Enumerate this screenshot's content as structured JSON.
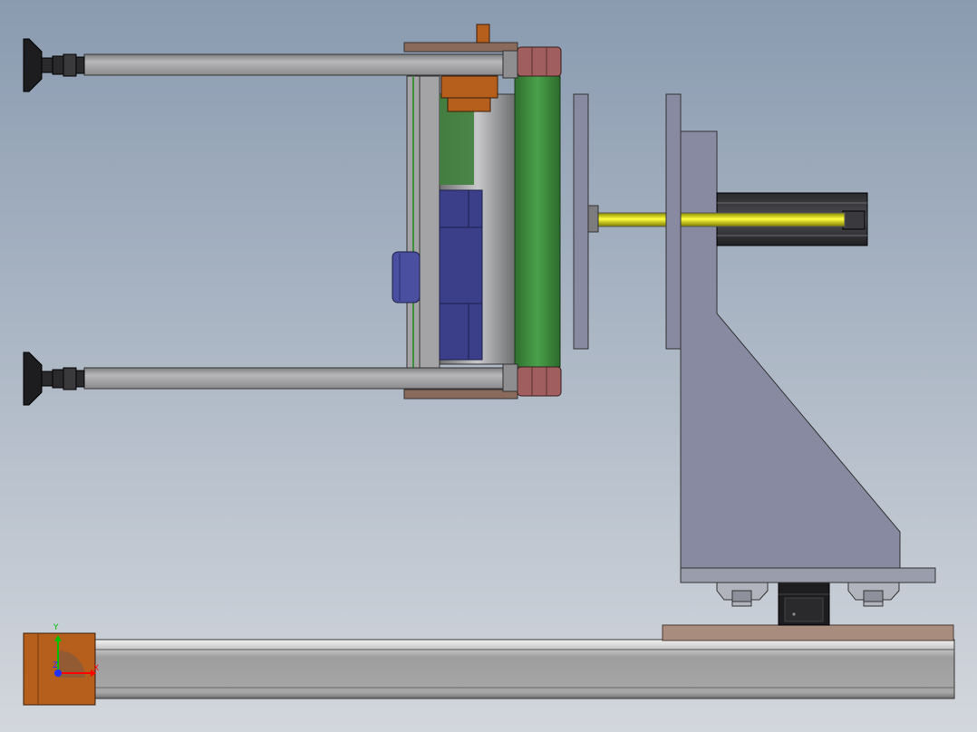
{
  "viewport": {
    "bg_top": "#8a9bb0",
    "bg_bottom": "#d3d7dd"
  },
  "palette": {
    "steel": "#a4a4a6",
    "steel_dark": "#5f6066",
    "plate_blue": "#878aa0",
    "roller_green": "#3e8e3e",
    "motor_blue": "#3b3f8a",
    "hex_red": "#a05f5e",
    "shaft_yellow": "#e2e200",
    "bracket_brown": "#8a6a5a",
    "orange_block": "#b65e1c",
    "tan_plate": "#a88d7e",
    "black": "#1d1d1f"
  },
  "model": {
    "parts": [
      "adjustable-foot",
      "tie-rod",
      "roller-frame",
      "green-roller",
      "gear-motor",
      "flange-plate",
      "yellow-shaft",
      "gusset-bracket",
      "linear-actuator",
      "linear-guide-rail",
      "carriage-plate",
      "stepper-motor"
    ]
  },
  "triad": {
    "x_label": "X",
    "y_label": "Y",
    "z_label": "Z",
    "x_color": "#ff0000",
    "y_color": "#00c000",
    "z_color": "#2030ff"
  }
}
